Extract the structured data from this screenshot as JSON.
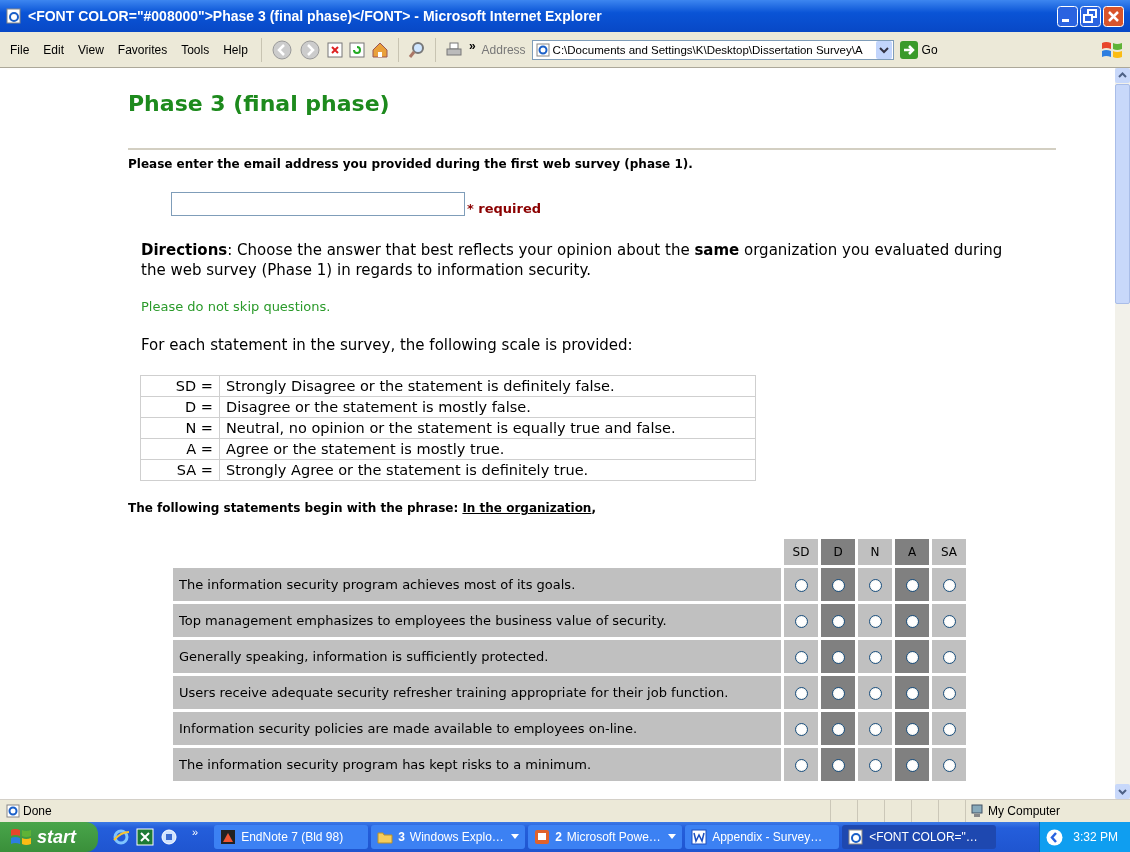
{
  "window": {
    "title": "<FONT COLOR=\"#008000\">Phase 3 (final phase)</FONT> - Microsoft Internet Explorer"
  },
  "menu": [
    "File",
    "Edit",
    "View",
    "Favorites",
    "Tools",
    "Help"
  ],
  "toolbar": {
    "overflow": "»",
    "address_label": "Address",
    "address": "C:\\Documents and Settings\\K\\Desktop\\Dissertation Survey\\A",
    "go": "Go"
  },
  "page": {
    "heading": "Phase 3 (final phase)",
    "email_prompt": "Please enter the email address you provided during the first web survey (phase 1).",
    "email_field": {
      "required": "* required"
    },
    "directions": "**Directions**: Choose the answer that best reflects your opinion about the **same** organization you evaluated during the web survey (Phase 1) in regards to information security.",
    "note": "Please do not skip questions.",
    "scale_intro": "For each statement in the survey, the following scale is provided:",
    "scale": [
      {
        "code": "SD =",
        "meaning": "Strongly Disagree or the statement is definitely false."
      },
      {
        "code": "D =",
        "meaning": "Disagree or the statement is mostly false."
      },
      {
        "code": "N =",
        "meaning": "Neutral, no opinion or the statement is equally true and false."
      },
      {
        "code": "A =",
        "meaning": "Agree or the statement is mostly true."
      },
      {
        "code": "SA =",
        "meaning": "Strongly Agree or the statement is definitely true."
      }
    ],
    "phrase_intro": "The following statements begin with the phrase: ",
    "phrase": "In the organization",
    "phrase_end": ",",
    "survey": {
      "columns": [
        {
          "label": "SD",
          "shaded": false
        },
        {
          "label": "D",
          "shaded": true
        },
        {
          "label": "N",
          "shaded": false
        },
        {
          "label": "A",
          "shaded": true
        },
        {
          "label": "SA",
          "shaded": false
        }
      ],
      "rows": [
        {
          "statement": "The information security program achieves most of its goals.",
          "answers": [
            false,
            false,
            false,
            false,
            false
          ]
        },
        {
          "statement": "Top management emphasizes to employees the business value of security.",
          "answers": [
            false,
            false,
            false,
            false,
            false
          ]
        },
        {
          "statement": "Generally speaking, information is sufficiently protected.",
          "answers": [
            false,
            false,
            false,
            false,
            false
          ]
        },
        {
          "statement": "Users receive adequate security refresher training appropriate for their job function.",
          "answers": [
            false,
            false,
            false,
            false,
            false
          ]
        },
        {
          "statement": "Information security policies are made available to employees on-line.",
          "answers": [
            false,
            false,
            false,
            false,
            false
          ]
        },
        {
          "statement": "The information security program has kept risks to a minimum.",
          "answers": [
            false,
            false,
            false,
            false,
            false
          ]
        }
      ]
    }
  },
  "status_bar": {
    "status": "Done",
    "zone": "My Computer"
  },
  "taskbar": {
    "start": "start",
    "overflow": "»",
    "tasks": [
      {
        "label": "EndNote 7 (Bld 98)",
        "active": false,
        "group": false
      },
      {
        "label": "Windows Explo…",
        "count": "3",
        "active": false,
        "group": true
      },
      {
        "label": "Microsoft Powe…",
        "count": "2",
        "active": false,
        "group": true
      },
      {
        "label": "Appendix - Survey…",
        "active": false,
        "group": false
      },
      {
        "label": "<FONT COLOR=\"…",
        "active": true,
        "group": false
      }
    ],
    "clock": "3:32 PM"
  }
}
